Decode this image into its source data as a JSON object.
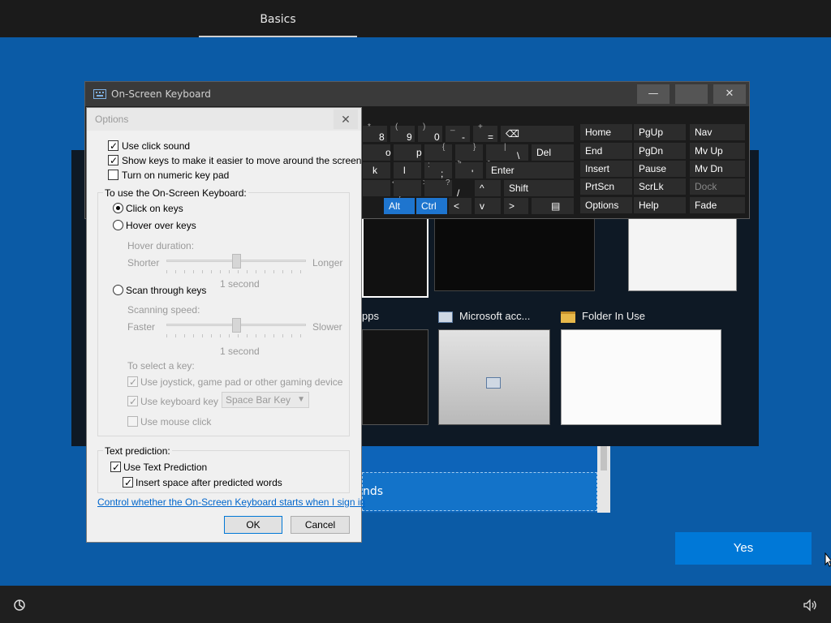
{
  "oobe": {
    "tab_label": "Basics",
    "yes_label": "Yes",
    "list_item_text": "nds"
  },
  "switcher": {
    "tiles": [
      {
        "label": "pps"
      },
      {
        "label": "Microsoft acc..."
      },
      {
        "label": "Folder In Use"
      }
    ]
  },
  "osk": {
    "title": "On-Screen Keyboard",
    "minimize": "—",
    "close": "✕",
    "keys": {
      "r1": [
        "8",
        "9",
        "0",
        "-",
        "=",
        "⌫"
      ],
      "r1_shift": [
        "*",
        "(",
        ")",
        "_",
        "+"
      ],
      "r2": [
        "o",
        "p",
        "[",
        "]",
        "\\",
        "Del"
      ],
      "r2_shift": [
        "{",
        "}",
        "|"
      ],
      "r3": [
        "k",
        "l",
        ";",
        "'",
        "Enter"
      ],
      "r3_shift": [
        ":",
        "\""
      ],
      "r4": [
        "<",
        ">",
        "?",
        "^",
        "Shift"
      ],
      "r4_base": [
        ",",
        ".",
        "/"
      ],
      "r5": [
        "Alt",
        "Ctrl",
        "<",
        "v",
        ">"
      ]
    },
    "nav_keys": [
      [
        "Home",
        "PgUp",
        "Nav"
      ],
      [
        "End",
        "PgDn",
        "Mv Up"
      ],
      [
        "Insert",
        "Pause",
        "Mv Dn"
      ],
      [
        "PrtScn",
        "ScrLk",
        "Dock"
      ],
      [
        "Options",
        "Help",
        "Fade"
      ]
    ]
  },
  "options": {
    "title": "Options",
    "close": "✕",
    "use_click_sound": "Use click sound",
    "show_keys": "Show keys to make it easier to move around the screen",
    "numeric_pad": "Turn on numeric key pad",
    "to_use_group": "To use the On-Screen Keyboard:",
    "click_on_keys": "Click on keys",
    "hover_over_keys": "Hover over keys",
    "hover_duration": "Hover duration:",
    "shorter": "Shorter",
    "longer": "Longer",
    "hover_value": "1 second",
    "scan_through_keys": "Scan through keys",
    "scanning_speed": "Scanning speed:",
    "faster": "Faster",
    "slower": "Slower",
    "scan_value": "1 second",
    "to_select_key": "To select a key:",
    "use_joystick": "Use joystick, game pad or other gaming device",
    "use_keyboard_key": "Use keyboard key",
    "keyboard_key_value": "Space Bar Key",
    "use_mouse_click": "Use mouse click",
    "text_prediction_group": "Text prediction:",
    "use_text_prediction": "Use Text Prediction",
    "insert_space": "Insert space after predicted words",
    "signin_link": "Control whether the On-Screen Keyboard starts when I sign in",
    "ok": "OK",
    "cancel": "Cancel",
    "hover_level": 0.5,
    "scan_level": 0.5
  },
  "colors": {
    "oobe_blue": "#0b5ba6",
    "accent": "#0078d7",
    "key_highlight": "#1e75cf"
  }
}
